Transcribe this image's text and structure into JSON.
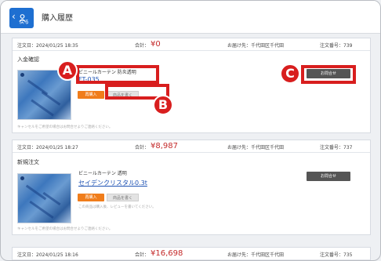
{
  "header": {
    "back_label": "戻る",
    "title": "購入履歴"
  },
  "orders": [
    {
      "date": "注文日：2024/01/25 18:35",
      "total_label": "合計：",
      "total_value": "¥0",
      "destination": "お届け先：千代田区千代田",
      "order_no": "注文番号：739",
      "status": "入金確認",
      "product_name": "ビニールカーテン 防炎透明",
      "product_link": "FT-035",
      "buy_again": "再購入",
      "review": "商品を書く",
      "note": "",
      "contact": "お問合せ",
      "cancel_note": "キャンセルをご希望の場合はお問合せよりご連絡ください。"
    },
    {
      "date": "注文日：2024/01/25 18:27",
      "total_label": "合計：",
      "total_value": "¥8,987",
      "destination": "お届け先：千代田区千代田",
      "order_no": "注文番号：737",
      "status": "新規注文",
      "product_name": "ビニールカーテン 透明",
      "product_link": "セイデンクリスタル0.3t",
      "buy_again": "再購入",
      "review": "商品を書く",
      "note": "この商品は購入後、レビューを書いてください。",
      "contact": "お問合せ",
      "cancel_note": "キャンセルをご希望の場合はお問合せよりご連絡ください。"
    },
    {
      "date": "注文日：2024/01/25 18:16",
      "total_label": "合計：",
      "total_value": "¥16,698",
      "destination": "お届け先：千代田区千代田",
      "order_no": "注文番号：735"
    }
  ],
  "callouts": [
    "A",
    "B",
    "C"
  ],
  "colors": {
    "accent": "#1e6fd1",
    "callout": "#d81e1e",
    "price": "#c42a2a",
    "buy_button": "#f07d1b"
  }
}
